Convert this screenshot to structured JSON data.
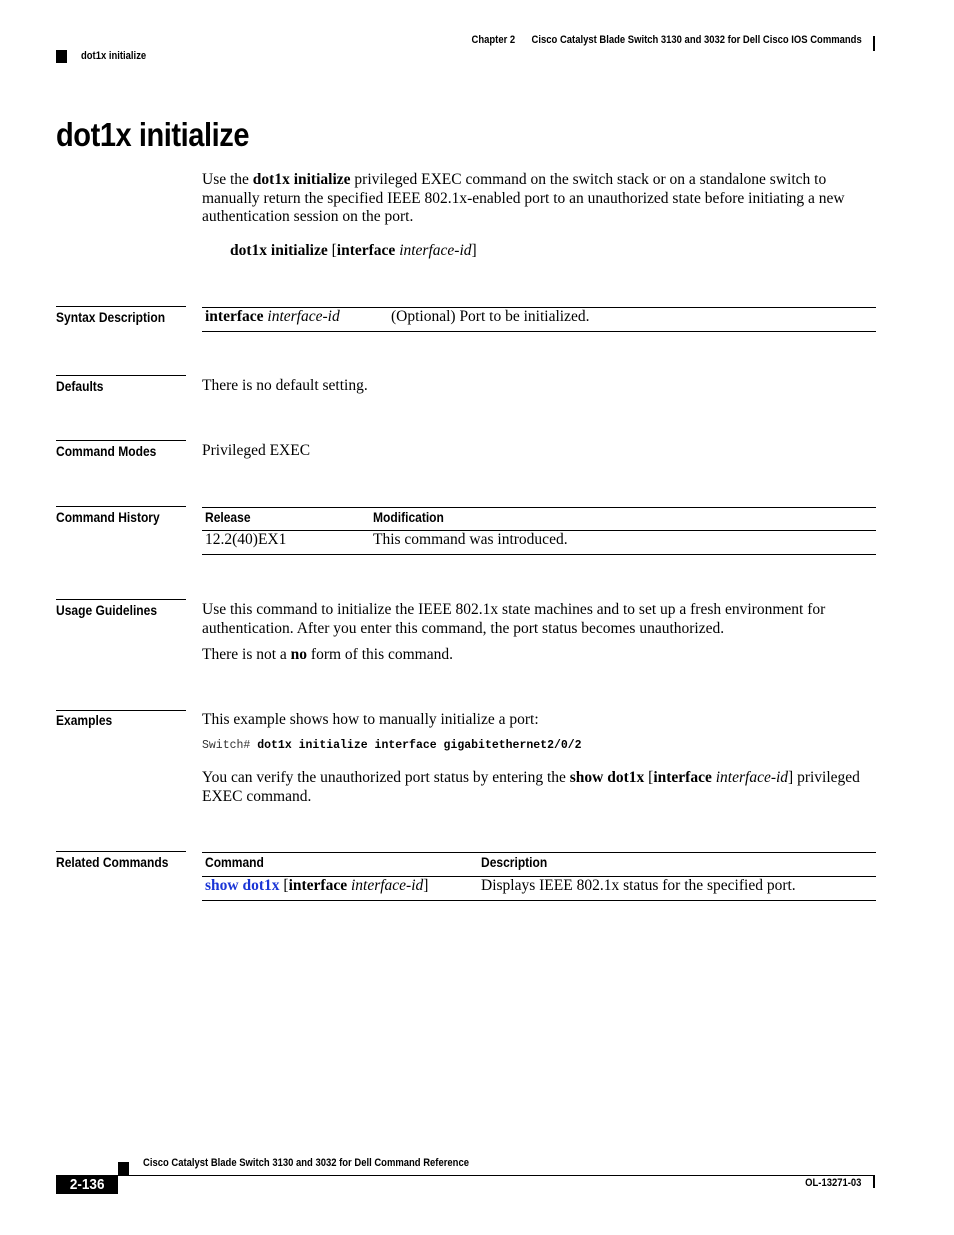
{
  "header": {
    "chapter": "Chapter 2",
    "book_section": "Cisco Catalyst Blade Switch 3130 and 3032 for Dell Cisco IOS Commands",
    "running_title": "dot1x initialize"
  },
  "title": "dot1x initialize",
  "intro": {
    "pre": "Use the ",
    "cmd": "dot1x initialize",
    "post": " privileged EXEC command on the switch stack or on a standalone switch to manually return the specified IEEE 802.1x-enabled port to an unauthorized state before initiating a new authentication session on the port."
  },
  "syntax": {
    "cmd": "dot1x initialize",
    "open": " [",
    "kw": "interface",
    "arg": "interface-id",
    "close": "]"
  },
  "sections": {
    "syntax_description": {
      "label": "Syntax Description",
      "rows": [
        {
          "kw": "interface",
          "arg": "interface-id",
          "description": "(Optional) Port to be initialized."
        }
      ]
    },
    "defaults": {
      "label": "Defaults",
      "text": "There is no default setting."
    },
    "command_modes": {
      "label": "Command Modes",
      "text": "Privileged EXEC"
    },
    "command_history": {
      "label": "Command History",
      "headers": [
        "Release",
        "Modification"
      ],
      "rows": [
        {
          "release": "12.2(40)EX1",
          "modification": "This command was introduced."
        }
      ]
    },
    "usage_guidelines": {
      "label": "Usage Guidelines",
      "para1": "Use this command to initialize the IEEE 802.1x state machines and to set up a fresh environment for authentication. After you enter this command, the port status becomes unauthorized.",
      "para2_pre": "There is not a ",
      "para2_bold": "no",
      "para2_post": " form of this command."
    },
    "examples": {
      "label": "Examples",
      "intro": "This example shows how to manually initialize a port:",
      "code_prompt": "Switch# ",
      "code_cmd": "dot1x initialize interface gigabitethernet2/0/2",
      "verify_pre": "You can verify the unauthorized port status by entering the ",
      "verify_cmd": "show dot1x",
      "verify_open": " [",
      "verify_kw": "interface",
      "verify_arg": "interface-id",
      "verify_close": "]",
      "verify_post": " privileged EXEC command."
    },
    "related_commands": {
      "label": "Related Commands",
      "headers": [
        "Command",
        "Description"
      ],
      "rows": [
        {
          "link": "show dot1x",
          "open": " [",
          "kw": "interface",
          "arg": "interface-id",
          "close": "]",
          "description": "Displays IEEE 802.1x status for the specified port."
        }
      ],
      "link_color": "#1a35d6"
    }
  },
  "footer": {
    "book_title": "Cisco Catalyst Blade Switch 3130 and 3032 for Dell Command Reference",
    "page_number": "2-136",
    "doc_number": "OL-13271-03"
  }
}
